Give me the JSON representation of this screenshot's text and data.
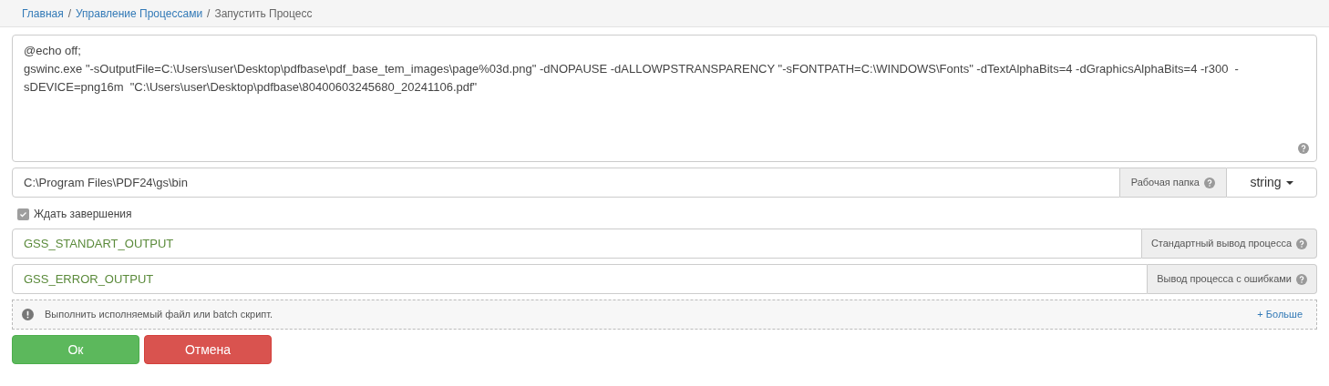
{
  "breadcrumb": [
    {
      "label": "Главная",
      "current": false
    },
    {
      "separator": "/",
      "label": "Управление Процессами",
      "current": false
    },
    {
      "separator": "/",
      "label": "Запустить Процесс",
      "current": true
    }
  ],
  "script": {
    "value": "@echo off;\ngswinc.exe \"-sOutputFile=C:\\Users\\user\\Desktop\\pdfbase\\pdf_base_tem_images\\page%03d.png\" -dNOPAUSE -dALLOWPSTRANSPARENCY \"-sFONTPATH=C:\\WINDOWS\\Fonts\" -dTextAlphaBits=4 -dGraphicsAlphaBits=4 -r300  -sDEVICE=png16m  \"C:\\Users\\user\\Desktop\\pdfbase\\80400603245680_20241106.pdf\""
  },
  "working_dir": {
    "value": "C:\\Program Files\\PDF24\\gs\\bin",
    "label": "Рабочая папка",
    "type": "string"
  },
  "wait": {
    "label": "Ждать завершения",
    "checked": true
  },
  "outputs": [
    {
      "value": "GSS_STANDART_OUTPUT",
      "label": "Стандартный вывод процесса"
    },
    {
      "value": "GSS_ERROR_OUTPUT",
      "label": "Вывод процесса с ошибками"
    }
  ],
  "info": {
    "text": "Выполнить исполняемый файл или batch скрипт.",
    "more": "+ Больше"
  },
  "buttons": [
    {
      "label": "Ок",
      "kind": "primary"
    },
    {
      "label": "Отмена",
      "kind": "danger"
    }
  ]
}
